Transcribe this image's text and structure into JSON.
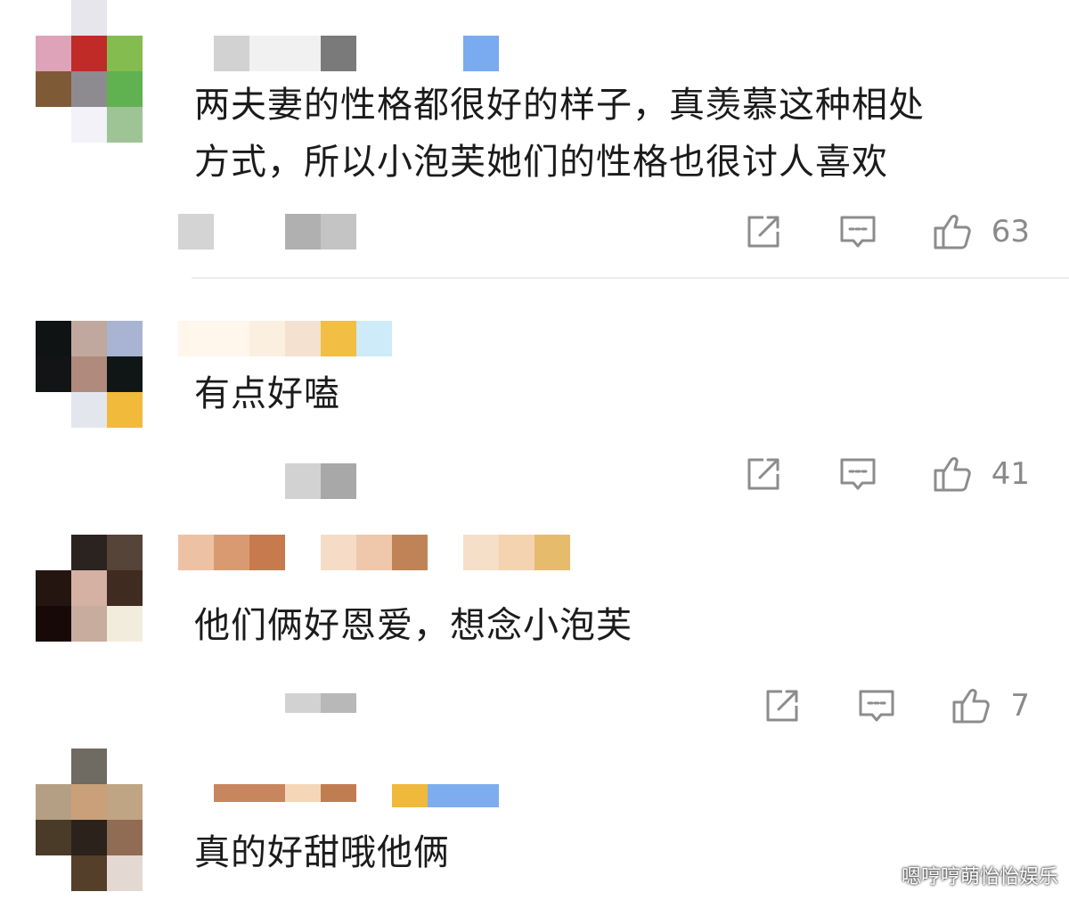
{
  "comments": [
    {
      "text": "两夫妻的性格都很好的样子，真羡慕这种相处\n方式，所以小泡芙她们的性格也很讨人喜欢",
      "likes": "63",
      "avatar_colors": [
        "#ffffff",
        "#e6e6ec",
        "#ffffff",
        "#dea3b8",
        "#c02a27",
        "#85bc4f",
        "#7e5a36",
        "#8e8b90",
        "#60b150",
        "#ffffff",
        "#f2f2f8",
        "#9ec496"
      ],
      "name_colors": [
        "#d2d2d2",
        "#f1f1f1",
        "#7a7a7a",
        "#7aaaf0"
      ],
      "meta_colors": [
        "#d4d4d4",
        "#b0b0b0",
        "#c4c4c4"
      ]
    },
    {
      "text": "有点好嗑",
      "likes": "41",
      "avatar_colors": [
        "#0f1314",
        "#c0a89e",
        "#a8b4d2",
        "#131415",
        "#b08a7c",
        "#101615",
        "#ffffff",
        "#e4e6ee",
        "#f1ba3a"
      ],
      "name_colors": [
        "#fff6ec",
        "#fbefe0",
        "#f5e1d0",
        "#f2be44",
        "#cdebf8"
      ],
      "meta_colors": [
        "#d2d2d2",
        "#a8a8a8"
      ]
    },
    {
      "text": "他们俩好恩爱，想念小泡芙",
      "likes": "7",
      "avatar_colors": [
        "#ffffff",
        "#2a2320",
        "#554437",
        "#241511",
        "#d4b1a3",
        "#3f2b20",
        "#170a06",
        "#c8ac9e",
        "#f1ecdc"
      ],
      "name_colors": [
        "#edc2a4",
        "#d99a72",
        "#c77a4e",
        "#f6dcc6",
        "#efc7aa",
        "#bf8357",
        "#f5dfc8",
        "#f3d3b0",
        "#e6bb6c"
      ],
      "meta_colors": [
        "#d2d2d2",
        "#b8b8b8"
      ]
    },
    {
      "text": "真的好甜哦他俩",
      "avatar_colors": [
        "#ffffff",
        "#6f6a62",
        "#ffffff",
        "#b49f85",
        "#c9a079",
        "#bfa583",
        "#4a3a28",
        "#2a221b",
        "#8f6c53",
        "#ffffff",
        "#533f2a",
        "#e3d8d2"
      ],
      "name_colors": [
        "#c8865e",
        "#f5d7b8",
        "#c17d52",
        "#efb93c",
        "#7eadef"
      ]
    }
  ],
  "icons": {
    "share": "share-icon",
    "reply": "comment-icon",
    "like": "thumbs-up-icon"
  },
  "watermark": "嗯哼哼萌怡怡娱乐"
}
